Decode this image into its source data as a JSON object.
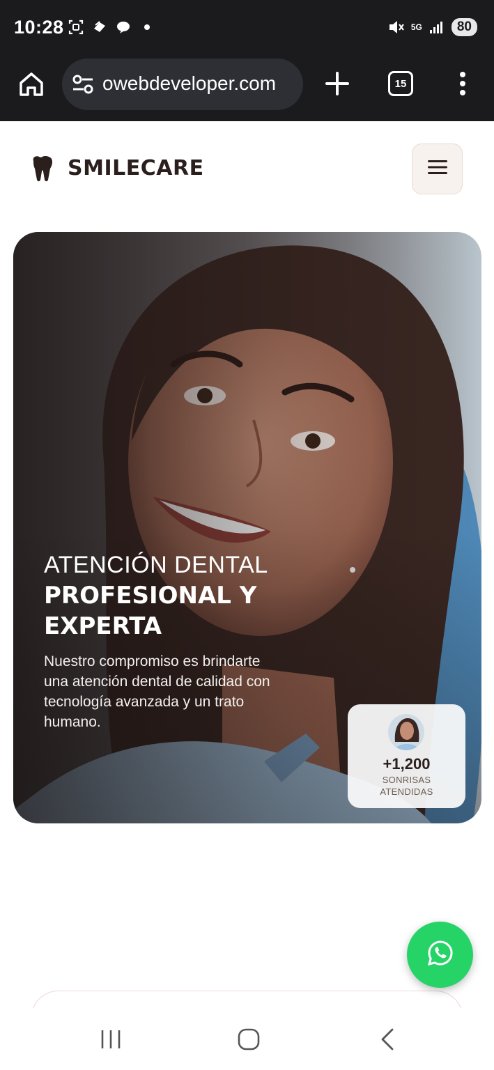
{
  "status_bar": {
    "time": "10:28",
    "battery": "80",
    "network": "5G"
  },
  "browser": {
    "url": "owebdeveloper.com",
    "tab_count": "15",
    "icons": [
      "home-icon",
      "site-settings-icon",
      "new-tab-icon",
      "tab-switcher-icon",
      "overflow-menu-icon"
    ]
  },
  "site": {
    "brand": "SMILECARE",
    "brand_icon": "tooth-icon",
    "menu_icon": "hamburger-icon"
  },
  "hero": {
    "line1": "ATENCIÓN DENTAL",
    "line2": "PROFESIONAL Y",
    "line3": "EXPERTA",
    "description": "Nuestro compromiso es brindarte una atención dental de calidad con tecnología avanzada y un trato humano.",
    "stat_number": "+1,200",
    "stat_label_1": "SONRISAS",
    "stat_label_2": "ATENDIDAS"
  },
  "fab": {
    "icon": "whatsapp-icon",
    "color": "#25d366"
  },
  "colors": {
    "brand_dark": "#2a1f1c",
    "chrome_dark": "#1b1b1d",
    "menu_button_bg": "#f7f2ee"
  }
}
